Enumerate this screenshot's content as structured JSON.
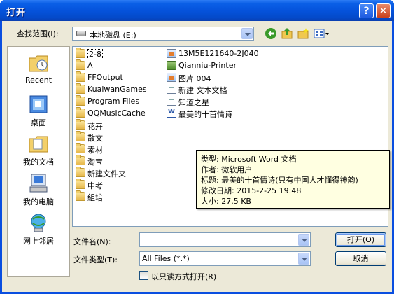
{
  "title": "打开",
  "titlebar": {
    "help_label": "?",
    "close_label": "✕"
  },
  "lookin": {
    "label": "查找范围(I):",
    "value": "本地磁盘 (E:)"
  },
  "toolbar": {
    "icons": [
      "back-icon",
      "up-folder-icon",
      "new-folder-icon",
      "view-menu-icon"
    ]
  },
  "places": [
    {
      "label": "Recent",
      "icon": "recent-icon"
    },
    {
      "label": "桌面",
      "icon": "desktop-icon"
    },
    {
      "label": "我的文档",
      "icon": "my-documents-icon"
    },
    {
      "label": "我的电脑",
      "icon": "my-computer-icon"
    },
    {
      "label": "网上邻居",
      "icon": "network-icon"
    }
  ],
  "files_col1": [
    {
      "name": "2-8",
      "type": "folder"
    },
    {
      "name": "A",
      "type": "folder"
    },
    {
      "name": "FFOutput",
      "type": "folder"
    },
    {
      "name": "KuaiwanGames",
      "type": "folder"
    },
    {
      "name": "Program Files",
      "type": "folder"
    },
    {
      "name": "QQMusicCache",
      "type": "folder"
    },
    {
      "name": "花卉",
      "type": "folder"
    },
    {
      "name": "散文",
      "type": "folder"
    },
    {
      "name": "素材",
      "type": "folder"
    },
    {
      "name": "淘宝",
      "type": "folder"
    },
    {
      "name": "新建文件夹",
      "type": "folder"
    },
    {
      "name": "中考",
      "type": "folder"
    },
    {
      "name": "組培",
      "type": "folder"
    }
  ],
  "files_col2": [
    {
      "name": "13M5E121640-2J040",
      "type": "image"
    },
    {
      "name": "Qianniu-Printer",
      "type": "printer"
    },
    {
      "name": "图片 004",
      "type": "image"
    },
    {
      "name": "新建 文本文档",
      "type": "text"
    },
    {
      "name": "知道之星",
      "type": "text"
    },
    {
      "name": "最美的十首情诗",
      "type": "word"
    }
  ],
  "tooltip": {
    "line1": "类型: Microsoft Word 文档",
    "line2": "作者: 微软用户",
    "line3": "标题: 最美的十首情诗(只有中国人才懂得神韵)",
    "line4": "修改日期: 2015-2-25 19:48",
    "line5": "大小: 27.5 KB"
  },
  "filename": {
    "label": "文件名(N):",
    "value": ""
  },
  "filetype": {
    "label": "文件类型(T):",
    "value": "All Files (*.*)"
  },
  "readonly": {
    "label": "以只读方式打开(R)",
    "checked": false
  },
  "buttons": {
    "open": "打开(O)",
    "cancel": "取消"
  }
}
